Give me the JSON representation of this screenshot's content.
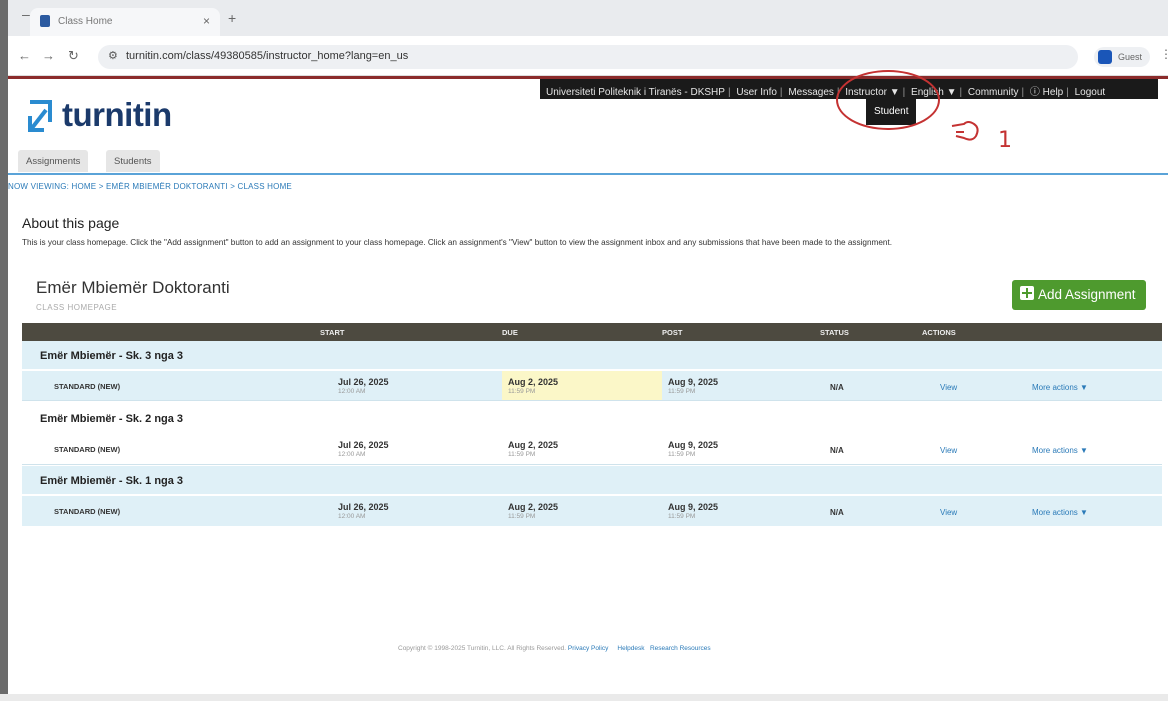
{
  "browser": {
    "tab_title": "Class Home",
    "url": "turnitin.com/class/49380585/instructor_home?lang=en_us",
    "profile_label": "Guest"
  },
  "topbar": {
    "institution": "Universiteti Politeknik i Tiranës - DKSHP",
    "user_info": "User Info",
    "messages": "Messages",
    "role": "Instructor ▼",
    "language": "English ▼",
    "community": "Community",
    "help": "Help",
    "logout": "Logout",
    "role_option": "Student"
  },
  "annotation": {
    "number": "1"
  },
  "logo": {
    "text": "turnitin",
    "color": "#1b3a6b"
  },
  "subnav": {
    "tabs": [
      "Assignments",
      "Students"
    ]
  },
  "breadcrumb": "NOW VIEWING: HOME > EMËR MBIEMËR DOKTORANTI > CLASS HOME",
  "about": {
    "heading": "About this page",
    "text": "This is your class homepage. Click the \"Add assignment\" button to add an assignment to your class homepage. Click an assignment's \"View\" button to view the assignment inbox and any submissions that have been made to the assignment."
  },
  "class": {
    "title": "Emër Mbiemër Doktoranti",
    "subtitle": "CLASS HOMEPAGE",
    "add_button": "Add Assignment",
    "accent": "#4e9a2e"
  },
  "table": {
    "headers": {
      "start": "START",
      "due": "DUE",
      "post": "POST",
      "status": "STATUS",
      "actions": "ACTIONS"
    },
    "groups": [
      {
        "name": "Emër Mbiemër - Sk. 3 nga 3",
        "type": "STANDARD (NEW)",
        "start_date": "Jul 26, 2025",
        "start_time": "12:00 AM",
        "due_date": "Aug 2, 2025",
        "due_time": "11:59 PM",
        "post_date": "Aug 9, 2025",
        "post_time": "11:59 PM",
        "status": "N/A",
        "view": "View",
        "more": "More actions ▼"
      },
      {
        "name": "Emër Mbiemër - Sk. 2 nga 3",
        "type": "STANDARD (NEW)",
        "start_date": "Jul 26, 2025",
        "start_time": "12:00 AM",
        "due_date": "Aug 2, 2025",
        "due_time": "11:59 PM",
        "post_date": "Aug 9, 2025",
        "post_time": "11:59 PM",
        "status": "N/A",
        "view": "View",
        "more": "More actions ▼"
      },
      {
        "name": "Emër Mbiemër - Sk. 1 nga 3",
        "type": "STANDARD (NEW)",
        "start_date": "Jul 26, 2025",
        "start_time": "12:00 AM",
        "due_date": "Aug 2, 2025",
        "due_time": "11:59 PM",
        "post_date": "Aug 9, 2025",
        "post_time": "11:59 PM",
        "status": "N/A",
        "view": "View",
        "more": "More actions ▼"
      }
    ]
  },
  "footer": {
    "copyright": "Copyright © 1998-2025 Turnitin, LLC. All Rights Reserved.",
    "privacy": "Privacy Policy",
    "helpdesk": "Helpdesk",
    "research": "Research Resources"
  }
}
